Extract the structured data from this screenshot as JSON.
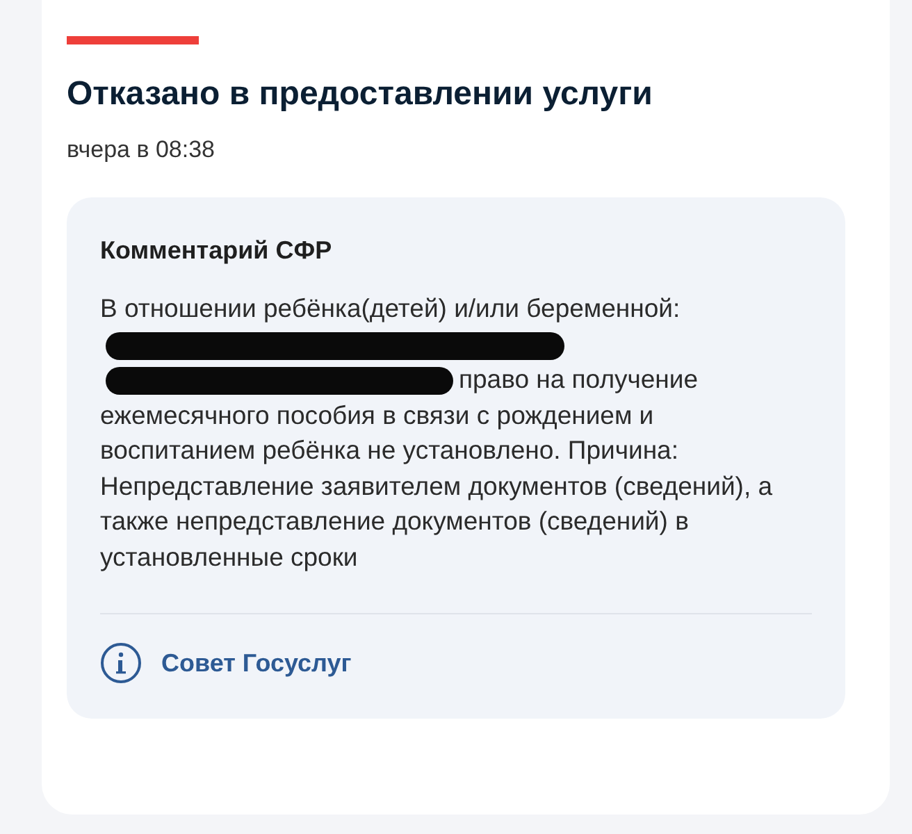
{
  "status": {
    "title": "Отказано в предоставлении услуги",
    "time": "вчера в 08:38"
  },
  "comment": {
    "heading": "Комментарий СФР",
    "text_before": "В отношении ребёнка(детей) и/или беременной:",
    "redacted": true,
    "text_after": "право на получение ежемесячного пособия в связи с рождением и воспитанием ребёнка не установлено. Причина: Непредставление заявителем документов (сведений), а также непредставление документов (сведений) в установленные сроки"
  },
  "advice_link": {
    "label": "Совет Госуслуг"
  }
}
